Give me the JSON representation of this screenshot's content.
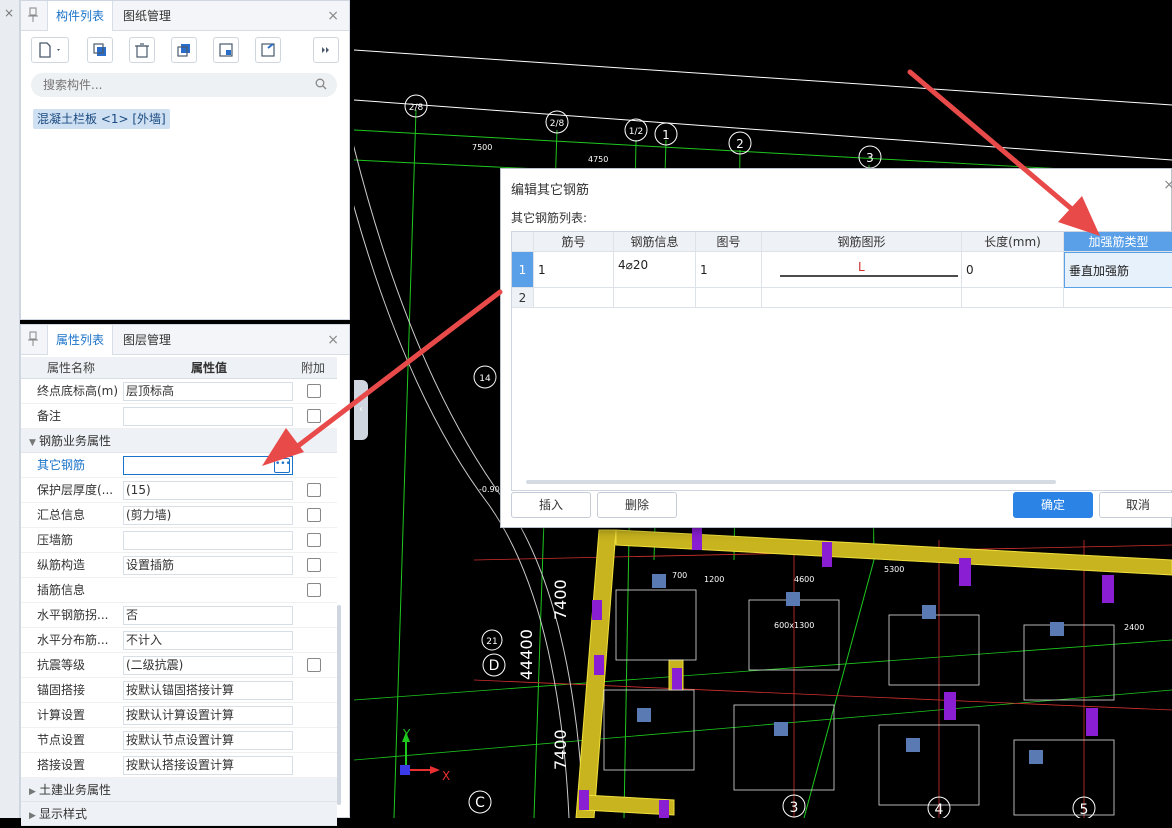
{
  "component_panel": {
    "tabs": [
      "构件列表",
      "图纸管理"
    ],
    "search_placeholder": "搜索构件...",
    "items": [
      "混凝土栏板 <1> [外墙]"
    ]
  },
  "property_panel": {
    "tabs": [
      "属性列表",
      "图层管理"
    ],
    "header": {
      "name": "属性名称",
      "value": "属性值",
      "extra": "附加"
    },
    "rows_top": [
      {
        "name": "终点底标高(m)",
        "value": "层顶标高"
      },
      {
        "name": "备注",
        "value": ""
      }
    ],
    "group_rebar": "钢筋业务属性",
    "rows_rebar": [
      {
        "name": "其它钢筋",
        "value": ""
      },
      {
        "name": "保护层厚度(...",
        "value": "(15)"
      },
      {
        "name": "汇总信息",
        "value": "(剪力墙)"
      },
      {
        "name": "压墙筋",
        "value": ""
      },
      {
        "name": "纵筋构造",
        "value": "设置插筋"
      },
      {
        "name": "插筋信息",
        "value": ""
      },
      {
        "name": "水平钢筋拐...",
        "value": "否"
      },
      {
        "name": "水平分布筋...",
        "value": "不计入"
      },
      {
        "name": "抗震等级",
        "value": "(二级抗震)"
      },
      {
        "name": "锚固搭接",
        "value": "按默认锚固搭接计算"
      },
      {
        "name": "计算设置",
        "value": "按默认计算设置计算"
      },
      {
        "name": "节点设置",
        "value": "按默认节点设置计算"
      },
      {
        "name": "搭接设置",
        "value": "按默认搭接设置计算"
      }
    ],
    "group_civil": "土建业务属性",
    "group_display": "显示样式"
  },
  "dialog": {
    "title": "编辑其它钢筋",
    "subtitle": "其它钢筋列表:",
    "columns": [
      "筋号",
      "钢筋信息",
      "图号",
      "钢筋图形",
      "长度(mm)",
      "加强筋类型"
    ],
    "rows": [
      {
        "index": "1",
        "bar_no": "1",
        "info": "4⌀20",
        "fig_no": "1",
        "shape_label": "L",
        "length": "0",
        "type": "垂直加强筋"
      },
      {
        "index": "2",
        "bar_no": "",
        "info": "",
        "fig_no": "",
        "shape_label": "",
        "length": "",
        "type": ""
      }
    ],
    "buttons": {
      "insert": "插入",
      "delete": "删除",
      "ok": "确定",
      "cancel": "取消"
    }
  },
  "canvas": {
    "axis_labels": [
      "2/8",
      "2/8",
      "1/2",
      "1",
      "2",
      "3",
      "14",
      "D",
      "21",
      "C",
      "3",
      "4",
      "5"
    ],
    "dimensions": [
      "7500",
      "4750",
      "7400",
      "7400",
      "44400",
      "4600",
      "5300",
      "1200",
      "2400",
      "700",
      "600x1300"
    ],
    "levels": [
      "-0.900"
    ],
    "axis_x": "X",
    "axis_y": "Y"
  },
  "colors": {
    "accent": "#1a73c9",
    "arrow": "#e84a4a",
    "cad_green": "#1ec81e",
    "cad_yellow": "#e6d21e"
  }
}
